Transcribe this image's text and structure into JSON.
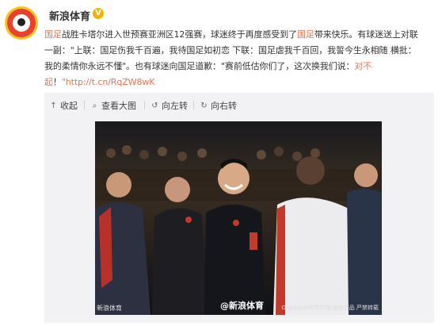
{
  "account": {
    "name": "新浪体育",
    "verified_mark": "V"
  },
  "post": {
    "line1": {
      "a": "国足",
      "b": "战胜卡塔尔进入世预赛亚洲区12强赛，球迷终于再度感受到了",
      "c": "国足",
      "d": "带来快乐。有球迷送上对联"
    },
    "line2": "一副：\"上联：国足伤我千百遍，我待国足如初恋 下联：国足虐我千百回，我誓今生永相随 横批：",
    "line3": "我的柔情你永远不懂\"。也有球迷向国足道歉：\"赛前低估你们了，这次换我们说：",
    "line3_red": "对不",
    "line4_red": "起",
    "line4_rest": "！",
    "link": "\"http://t.cn/RqZW8wK"
  },
  "toolbar": {
    "collapse": "收起",
    "view_large": "查看大图",
    "rotate_left": "向左转",
    "rotate_right": "向右转"
  },
  "photo": {
    "watermark_left": "新浪体育",
    "watermark_center": "@新浪体育",
    "watermark_right": "Osports全体育传媒  版权作品 严禁转载"
  },
  "colors": {
    "highlight": "#eb7350",
    "media_bg": "#f2f2f5",
    "text": "#333333"
  }
}
